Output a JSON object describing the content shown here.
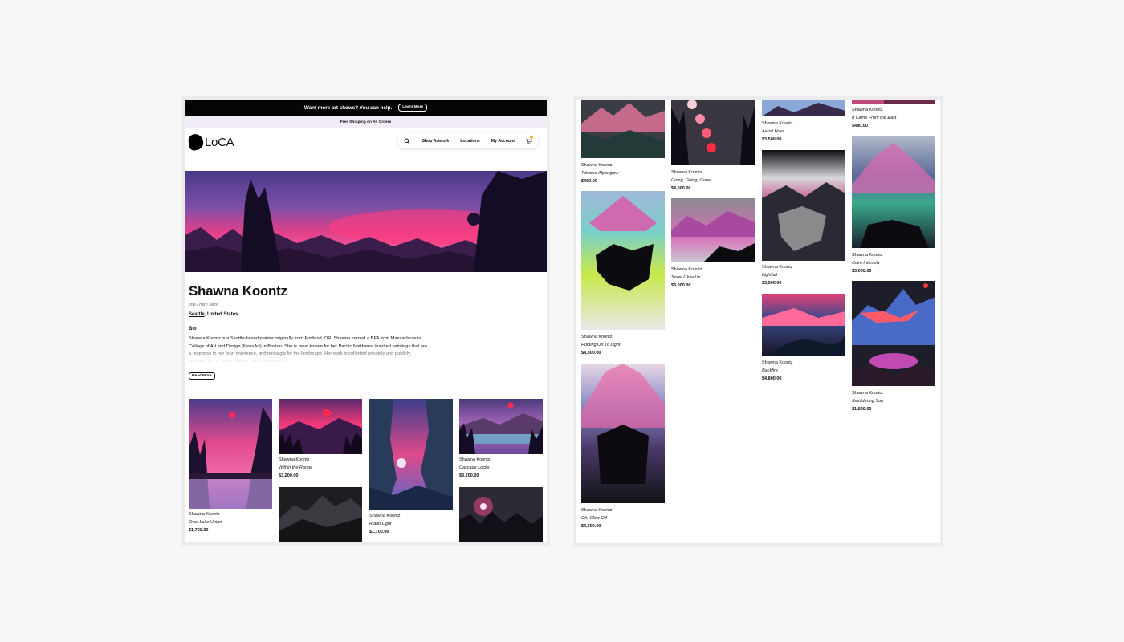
{
  "promo": {
    "text": "Want more art shows? You can help.",
    "button": "Learn More"
  },
  "shipping": "Free Shipping on All Orders",
  "brand": "LoCA",
  "nav": {
    "shop": "Shop Artwork",
    "locations": "Locations",
    "account": "My Account"
  },
  "artist": {
    "name": "Shawna Koontz",
    "pronouns": "she / her / hers",
    "city": "Seattle",
    "country": ", United States",
    "bio_heading": "Bio",
    "bio": "Shawna Koontz is a Seattle-based painter originally from Portland, OR. Shawna earned a BFA from Massachusetts College of Art and Design (MassArt) in Boston. She is most known for her Pacific Northwest inspired paintings that are a response to her fear, reverence, and nostalgia for the landscape. Her work is collected privately and publicly, including the W Hotel and the City of Bellevue in",
    "read_more": "Read More"
  },
  "left_artworks": [
    {
      "artist": "Shawna Koontz",
      "title": "Over Lake Union",
      "price": "$1,700.00"
    },
    {
      "artist": "Shawna Koontz",
      "title": "Within the Range",
      "price": "$3,200.00"
    },
    {
      "artist": "Shawna Koontz",
      "title": "Rialto Light",
      "price": "$1,700.00"
    },
    {
      "artist": "Shawna Koontz",
      "title": "Cascade Locks",
      "price": "$3,200.00"
    }
  ],
  "right_artworks": [
    {
      "artist": "Shawna Koontz",
      "title": "Tahoma Alpenglow",
      "price": "$480.00"
    },
    {
      "artist": "Shawna Koontz",
      "title": "Holding On To Light",
      "price": "$4,300.00"
    },
    {
      "artist": "Shawna Koontz",
      "title": "Oh, Glow Off",
      "price": "$4,300.00"
    },
    {
      "artist": "Shawna Koontz",
      "title": "Going, Going, Gone",
      "price": "$4,000.00"
    },
    {
      "artist": "Shawna Koontz",
      "title": "Snow Glow Up",
      "price": "$3,000.00"
    },
    {
      "artist": "Shawna Koontz",
      "title": "Aerial Hues",
      "price": "$3,500.00"
    },
    {
      "artist": "Shawna Koontz",
      "title": "Lightfall",
      "price": "$3,500.00"
    },
    {
      "artist": "Shawna Koontz",
      "title": "Backfire",
      "price": "$4,800.00"
    },
    {
      "artist": "Shawna Koontz",
      "title": "It Came From the East",
      "price": "$480.00"
    },
    {
      "artist": "Shawna Koontz",
      "title": "Calm Intensity",
      "price": "$3,000.00"
    },
    {
      "artist": "Shawna Koontz",
      "title": "Smoldering Sun",
      "price": "$1,800.00"
    }
  ]
}
